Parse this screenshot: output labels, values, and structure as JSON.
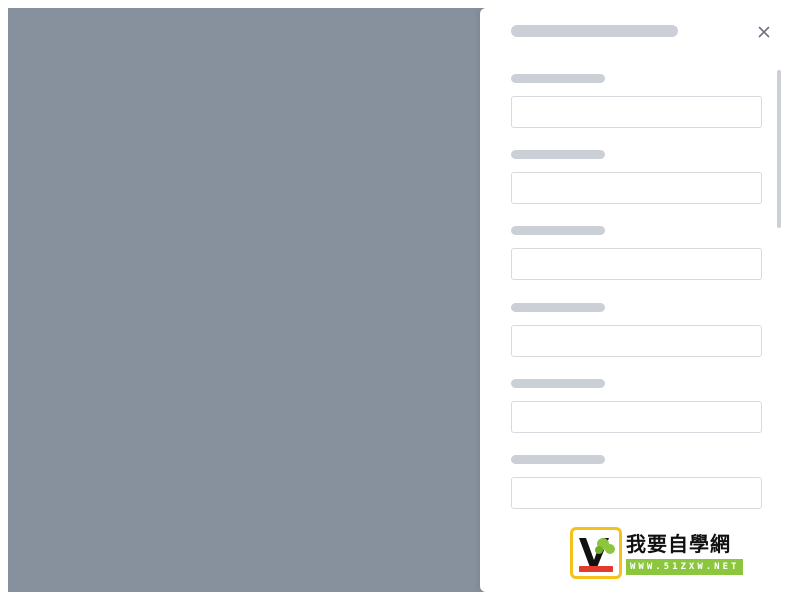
{
  "colors": {
    "backdrop": "#87919e",
    "drawer": "#ffffff",
    "skeleton": "#cbcfd6",
    "input_border": "#d7dbe0"
  },
  "drawer": {
    "close_icon": "close-icon",
    "field_count": 6
  },
  "watermark": {
    "title": "我要自學網",
    "url": "WWW.51ZXW.NET"
  }
}
